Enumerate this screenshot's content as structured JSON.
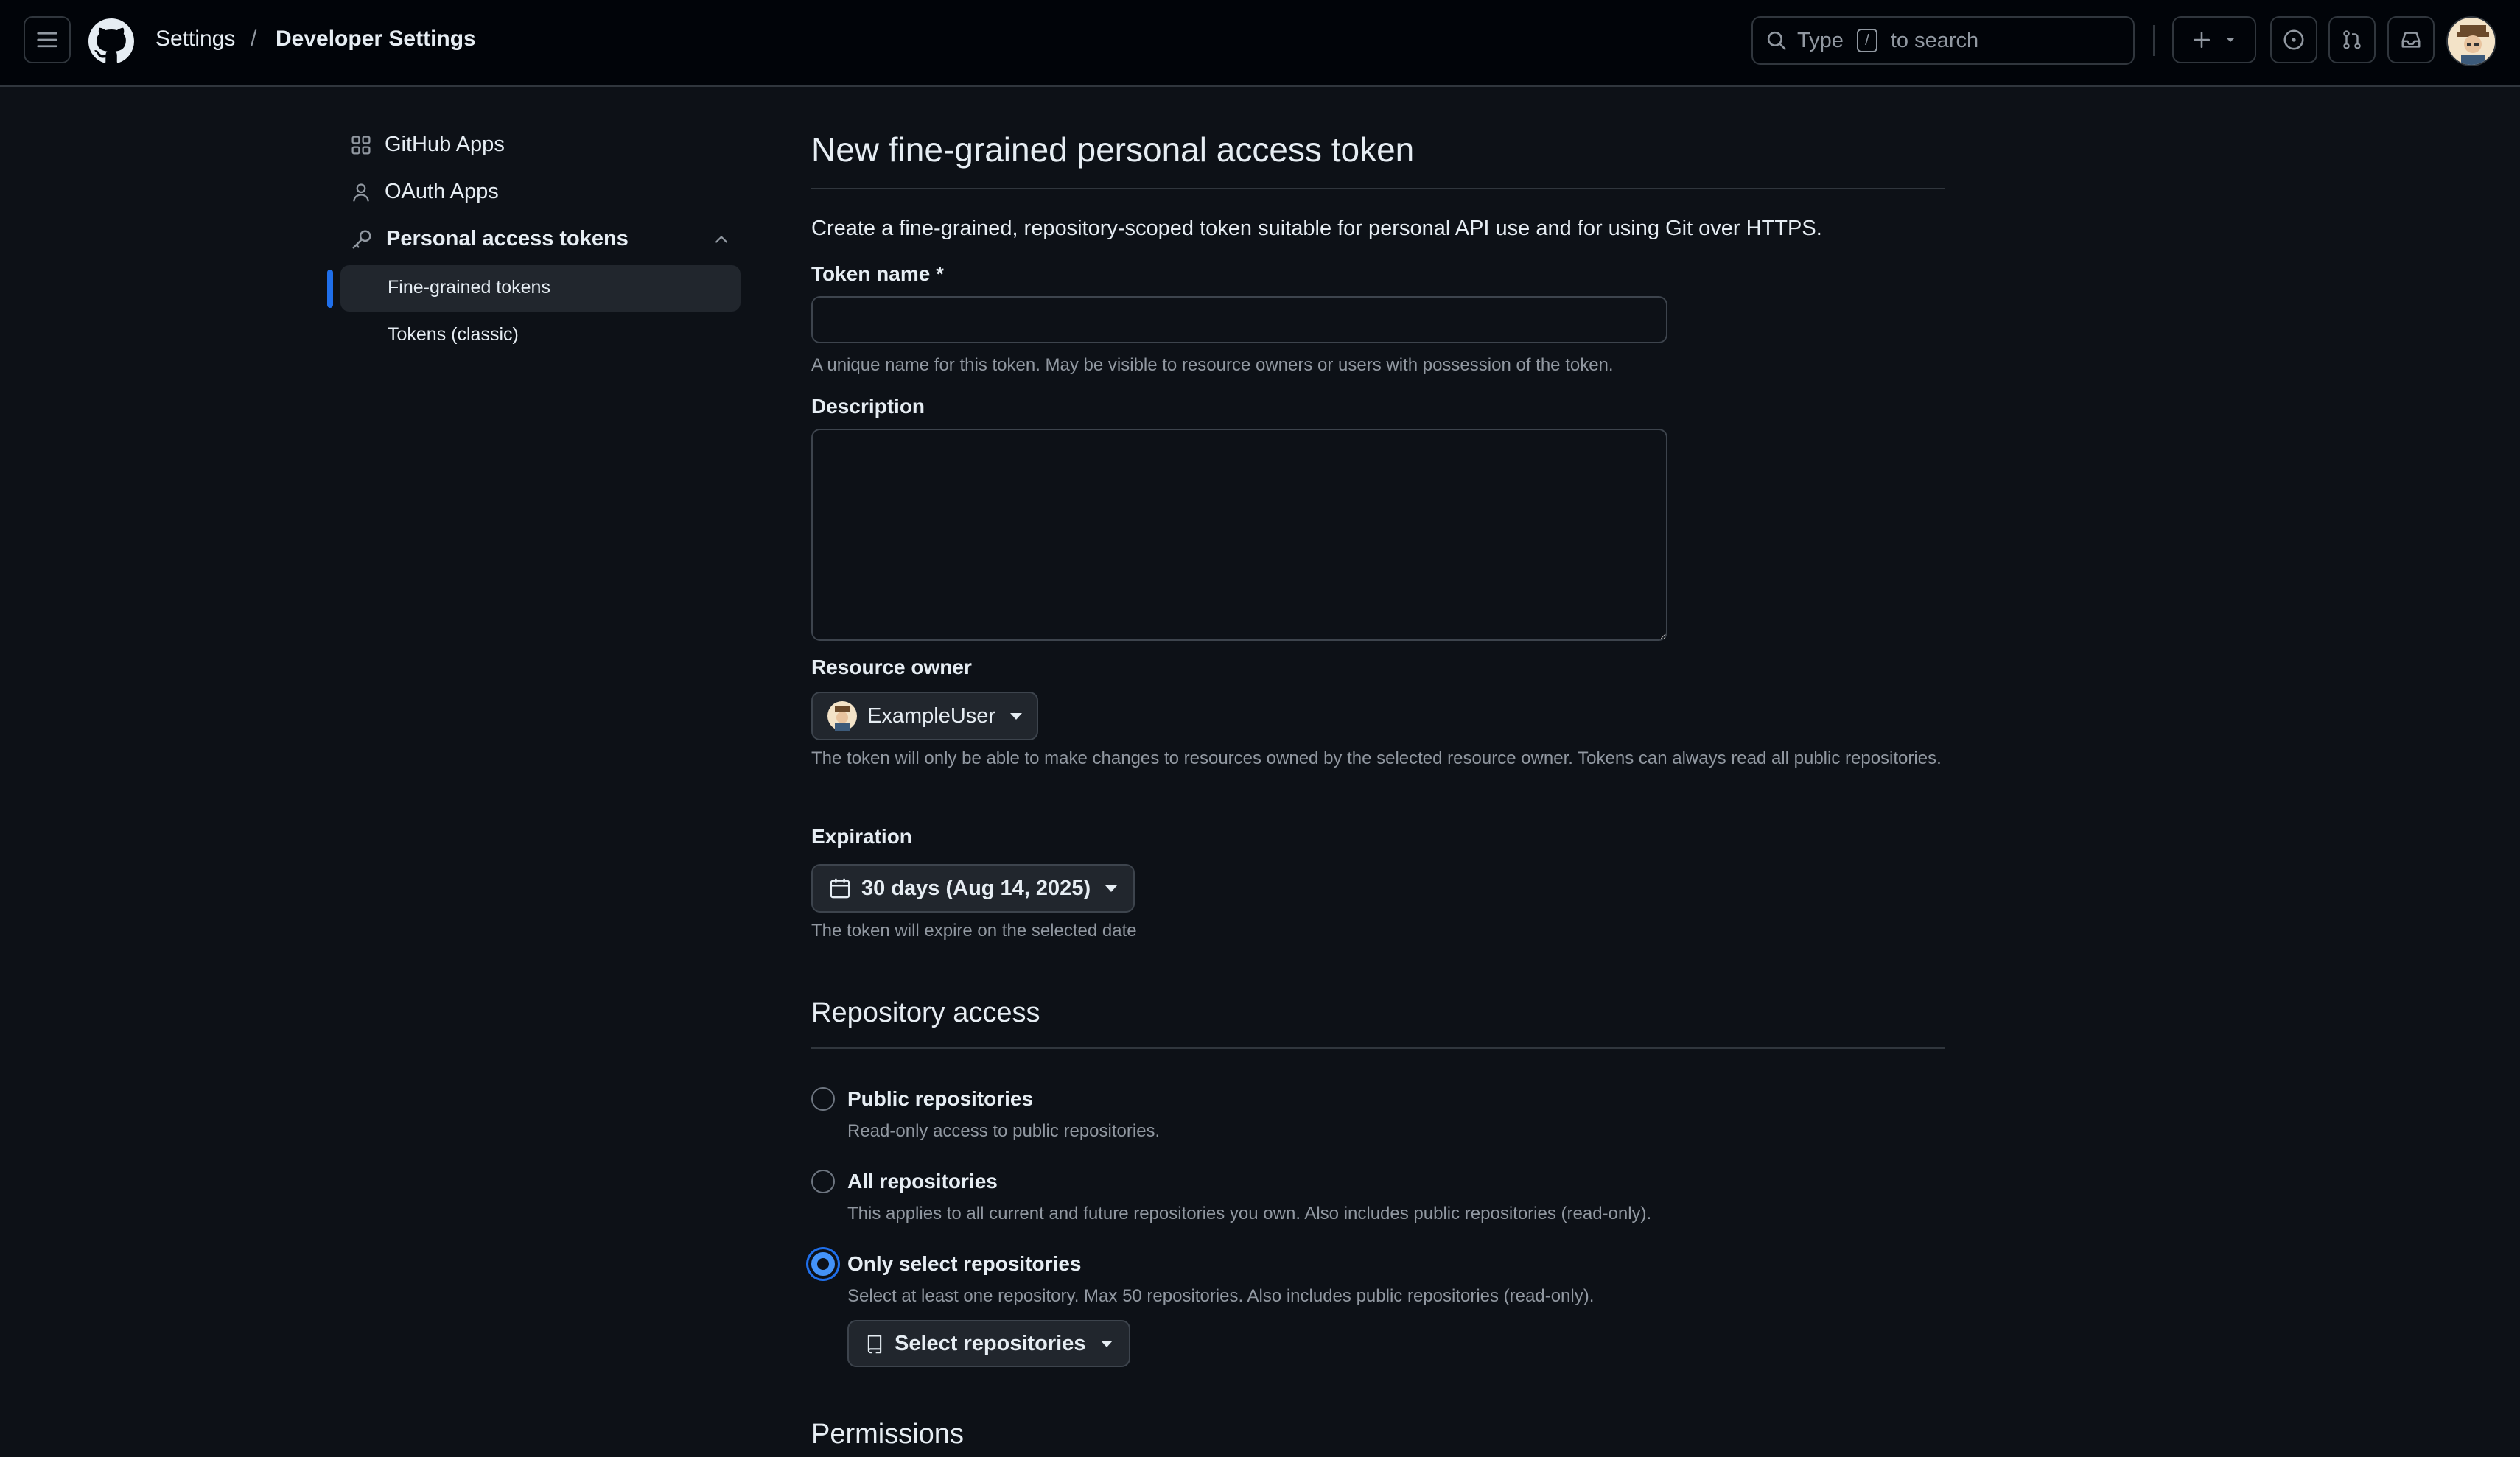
{
  "header": {
    "breadcrumb": [
      "Settings",
      "/",
      "Developer Settings"
    ],
    "search": {
      "prefix": "Type",
      "key": "/",
      "suffix": "to search"
    }
  },
  "sidebar": {
    "items": [
      {
        "label": "GitHub Apps",
        "icon": "apps-grid-icon"
      },
      {
        "label": "OAuth Apps",
        "icon": "person-icon"
      },
      {
        "label": "Personal access tokens",
        "icon": "key-icon",
        "expanded": true
      }
    ],
    "subitems": [
      {
        "label": "Fine-grained tokens",
        "active": true
      },
      {
        "label": "Tokens (classic)",
        "active": false
      }
    ]
  },
  "main": {
    "title": "New fine-grained personal access token",
    "intro": "Create a fine-grained, repository-scoped token suitable for personal API use and for using Git over HTTPS.",
    "token_name": {
      "label": "Token name *",
      "value": "",
      "note": "A unique name for this token. May be visible to resource owners or users with possession of the token."
    },
    "description": {
      "label": "Description",
      "value": ""
    },
    "resource_owner": {
      "label": "Resource owner",
      "value": "ExampleUser",
      "note": "The token will only be able to make changes to resources owned by the selected resource owner. Tokens can always read all public repositories."
    },
    "expiration": {
      "label": "Expiration",
      "value": "30 days (Aug 14, 2025)",
      "note": "The token will expire on the selected date"
    },
    "repo_access": {
      "title": "Repository access",
      "options": [
        {
          "title": "Public repositories",
          "desc": "Read-only access to public repositories.",
          "checked": false
        },
        {
          "title": "All repositories",
          "desc": "This applies to all current and future repositories you own. Also includes public repositories (read-only).",
          "checked": false
        },
        {
          "title": "Only select repositories",
          "desc": "Select at least one repository. Max 50 repositories. Also includes public repositories (read-only).",
          "checked": true
        }
      ],
      "select_button": "Select repositories"
    },
    "permissions_title": "Permissions"
  },
  "colors": {
    "accent": "#1f6feb",
    "background": "#0d1117",
    "header": "#010409"
  }
}
